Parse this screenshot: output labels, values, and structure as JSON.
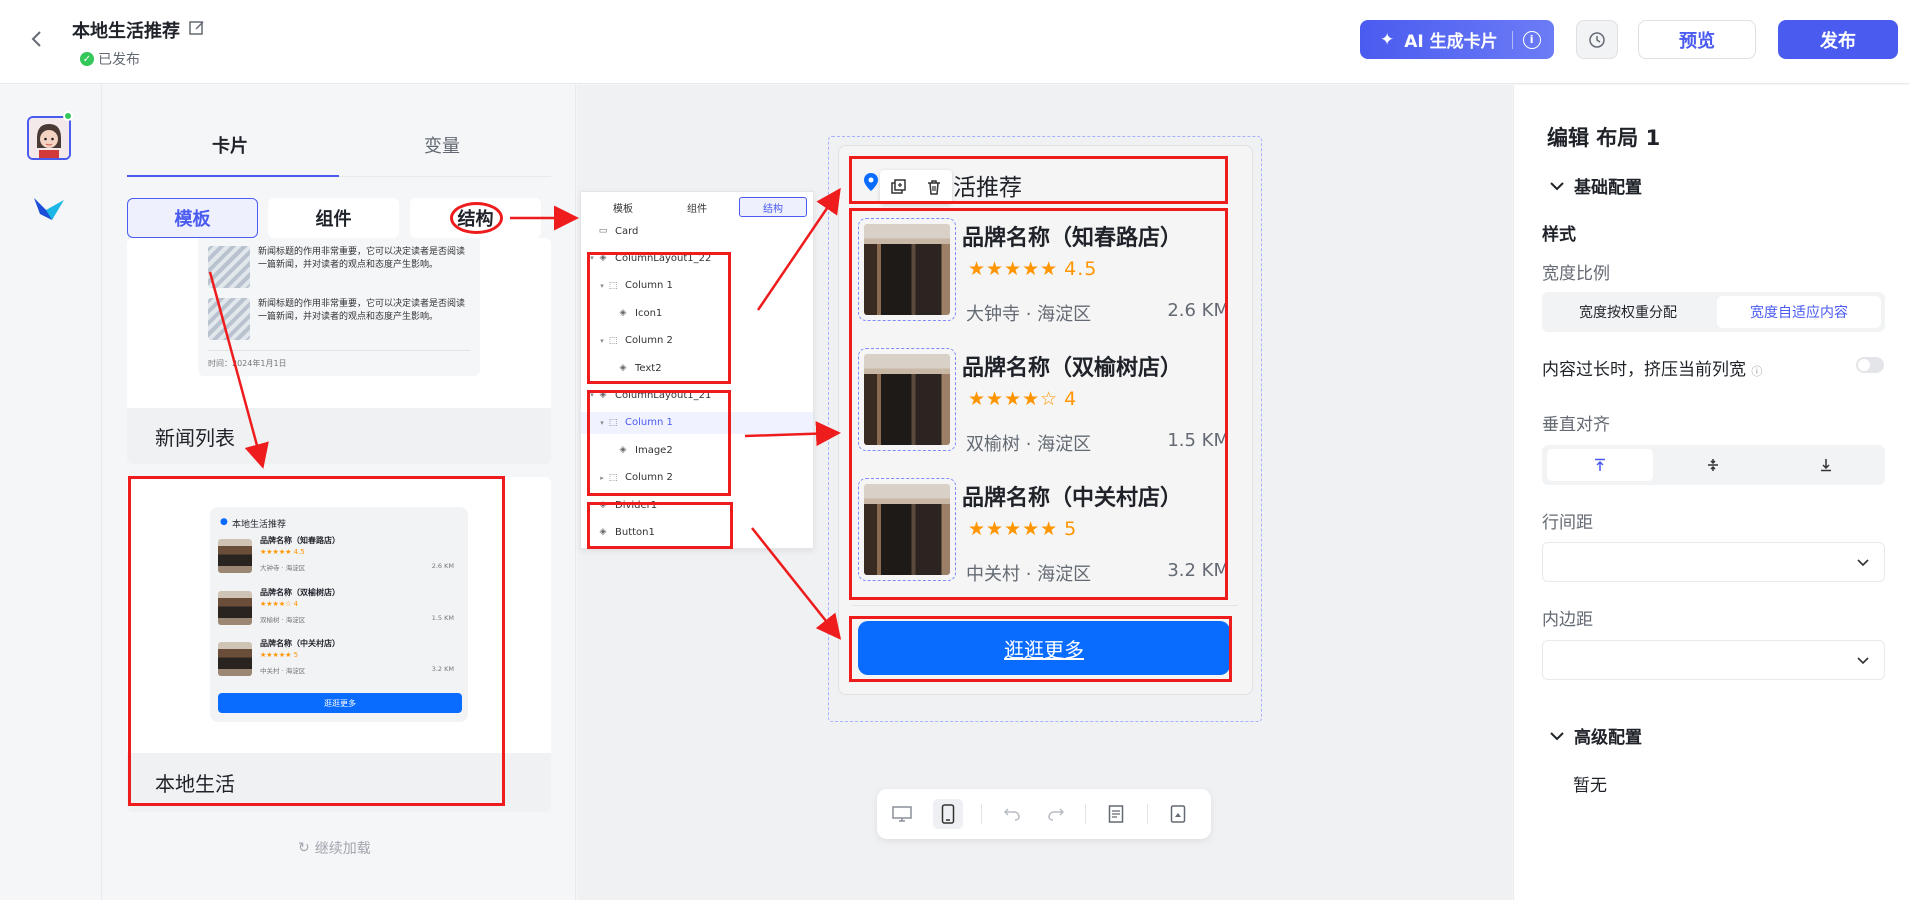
{
  "header": {
    "title": "本地生活推荐",
    "status": "已发布",
    "ai_button": "AI 生成卡片",
    "preview": "预览",
    "publish": "发布"
  },
  "library": {
    "tabs": [
      "卡片",
      "变量"
    ],
    "segments": [
      "模板",
      "组件",
      "结构"
    ],
    "news_items": [
      "新闻标题的作用非常重要，它可以决定读者是否阅读一篇新闻，并对读者的观点和态度产生影响。",
      "新闻标题的作用非常重要，它可以决定读者是否阅读一篇新闻，并对读者的观点和态度产生影响。"
    ],
    "news_time": "时间：2024年1月1日",
    "news_card_label": "新闻列表",
    "local_card_label": "本地生活",
    "load_more": "继续加载",
    "mini": {
      "title": "本地生活推荐",
      "button": "逛逛更多",
      "rows": [
        {
          "name": "品牌名称（知春路店）",
          "stars": "★★★★★",
          "rating": "4.5",
          "loc": "大钟寺 · 海淀区",
          "dist": "2.6 KM"
        },
        {
          "name": "品牌名称（双榆树店）",
          "stars": "★★★★☆",
          "rating": "4",
          "loc": "双榆树 · 海淀区",
          "dist": "1.5 KM"
        },
        {
          "name": "品牌名称（中关村店）",
          "stars": "★★★★★",
          "rating": "5",
          "loc": "中关村 · 海淀区",
          "dist": "3.2 KM"
        }
      ]
    }
  },
  "tree": {
    "tabs": [
      "模板",
      "组件",
      "结构"
    ],
    "rows": [
      {
        "label": "Card",
        "caret": "",
        "icon": "▭",
        "indent": 0,
        "selected": false
      },
      {
        "label": "ColumnLayout1_22",
        "caret": "▾",
        "icon": "◈",
        "indent": 0,
        "selected": false
      },
      {
        "label": "Column 1",
        "caret": "▾",
        "icon": "⬚",
        "indent": 1,
        "selected": false
      },
      {
        "label": "Icon1",
        "caret": "",
        "icon": "◈",
        "indent": 2,
        "selected": false
      },
      {
        "label": "Column 2",
        "caret": "▾",
        "icon": "⬚",
        "indent": 1,
        "selected": false
      },
      {
        "label": "Text2",
        "caret": "",
        "icon": "◈",
        "indent": 2,
        "selected": false
      },
      {
        "label": "ColumnLayout1_21",
        "caret": "▾",
        "icon": "◈",
        "indent": 0,
        "selected": false
      },
      {
        "label": "Column 1",
        "caret": "▾",
        "icon": "⬚",
        "indent": 1,
        "selected": true
      },
      {
        "label": "Image2",
        "caret": "",
        "icon": "◈",
        "indent": 2,
        "selected": false
      },
      {
        "label": "Column 2",
        "caret": "▸",
        "icon": "⬚",
        "indent": 1,
        "selected": false
      },
      {
        "label": "Divider1",
        "caret": "",
        "icon": "◈",
        "indent": 0,
        "selected": false
      },
      {
        "label": "Button1",
        "caret": "",
        "icon": "◈",
        "indent": 0,
        "selected": false
      }
    ]
  },
  "canvas": {
    "card_title": "本地生活推荐",
    "card_title_visible": "活推荐",
    "button": "逛逛更多",
    "shops": [
      {
        "name": "品牌名称（知春路店）",
        "stars": "★★★★★",
        "rating": "4.5",
        "loc": "大钟寺 · 海淀区",
        "dist": "2.6 KM"
      },
      {
        "name": "品牌名称（双榆树店）",
        "stars": "★★★★☆",
        "rating": "4",
        "loc": "双榆树 · 海淀区",
        "dist": "1.5 KM"
      },
      {
        "name": "品牌名称（中关村店）",
        "stars": "★★★★★",
        "rating": "5",
        "loc": "中关村 · 海淀区",
        "dist": "3.2 KM"
      }
    ]
  },
  "props": {
    "title": "编辑 布局 1",
    "basic": "基础配置",
    "style": "样式",
    "width_ratio": "宽度比例",
    "width_options": [
      "宽度按权重分配",
      "宽度自适应内容"
    ],
    "squeeze": "内容过长时，挤压当前列宽",
    "valign": "垂直对齐",
    "line_spacing": "行间距",
    "padding": "内边距",
    "advanced": "高级配置",
    "none": "暂无"
  },
  "colors": {
    "accent": "#4a5bf0",
    "cta_blue": "#0a6cff",
    "star": "#ff9500",
    "annotation_red": "#ee1c1c"
  }
}
